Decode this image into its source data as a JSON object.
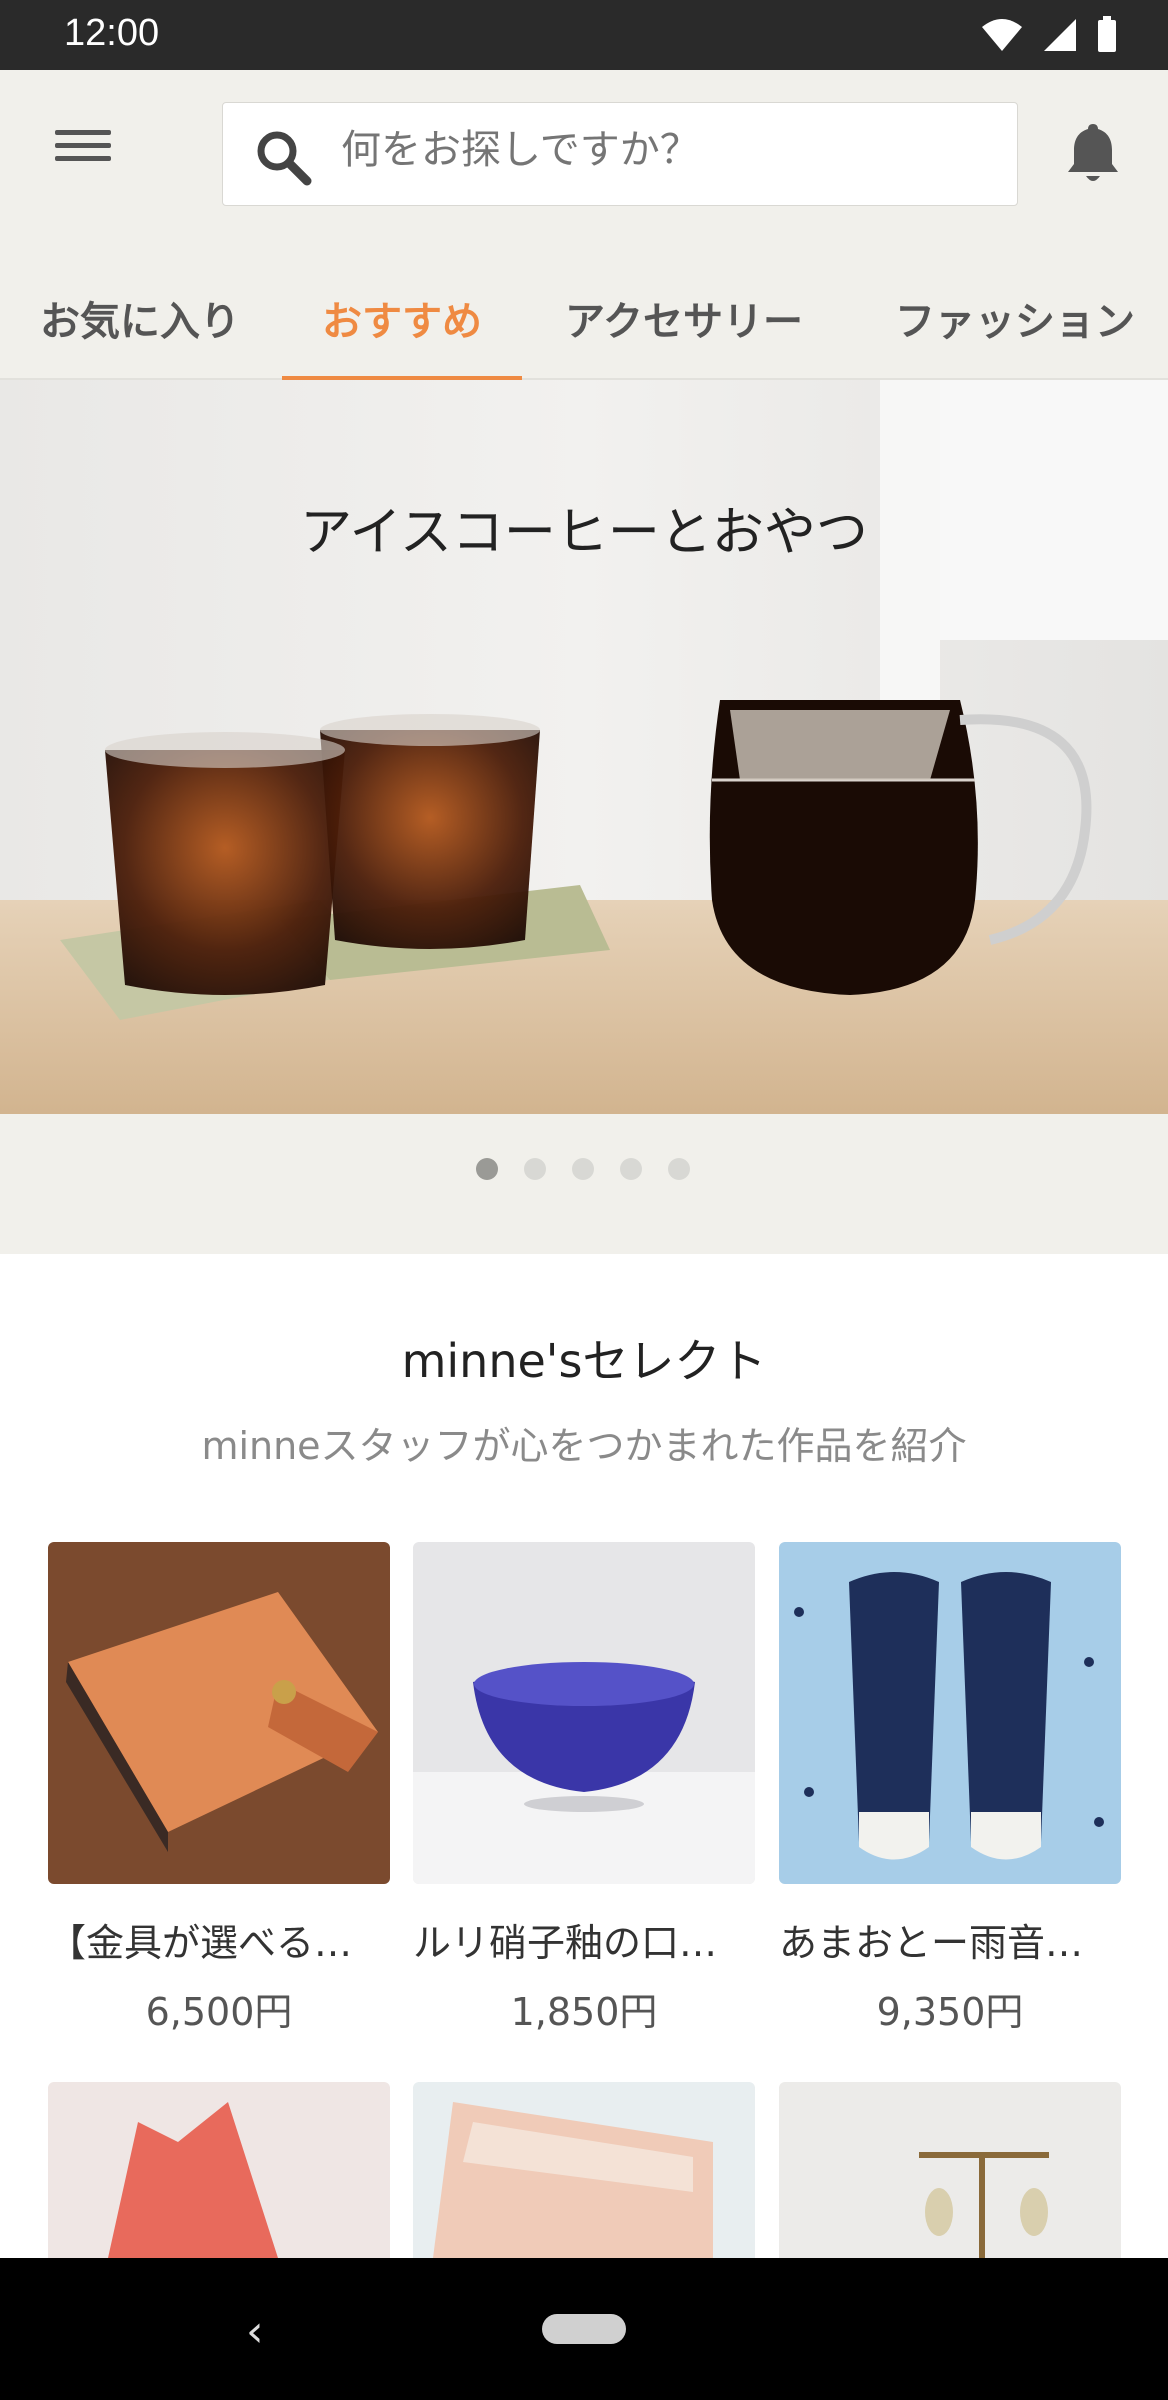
{
  "status": {
    "time": "12:00"
  },
  "search": {
    "placeholder": "何をお探しですか？"
  },
  "tabs": [
    {
      "label": "お気に入り"
    },
    {
      "label": "おすすめ",
      "active": true
    },
    {
      "label": "アクセサリー"
    },
    {
      "label": "ファッション"
    }
  ],
  "hero": {
    "title": "アイスコーヒーとおやつ",
    "slide_count": 5,
    "active_slide": 1
  },
  "select": {
    "title": "minne'sセレクト",
    "subtitle": "minneスタッフが心をつかまれた作品を紹介",
    "items": [
      {
        "name": "【金具が選べる…",
        "price": "6,500円"
      },
      {
        "name": "ルリ硝子釉の口…",
        "price": "1,850円"
      },
      {
        "name": "あまおとー雨音…",
        "price": "9,350円"
      }
    ]
  },
  "colors": {
    "accent": "#ef8a42",
    "header_bg": "#f1f0eb"
  }
}
